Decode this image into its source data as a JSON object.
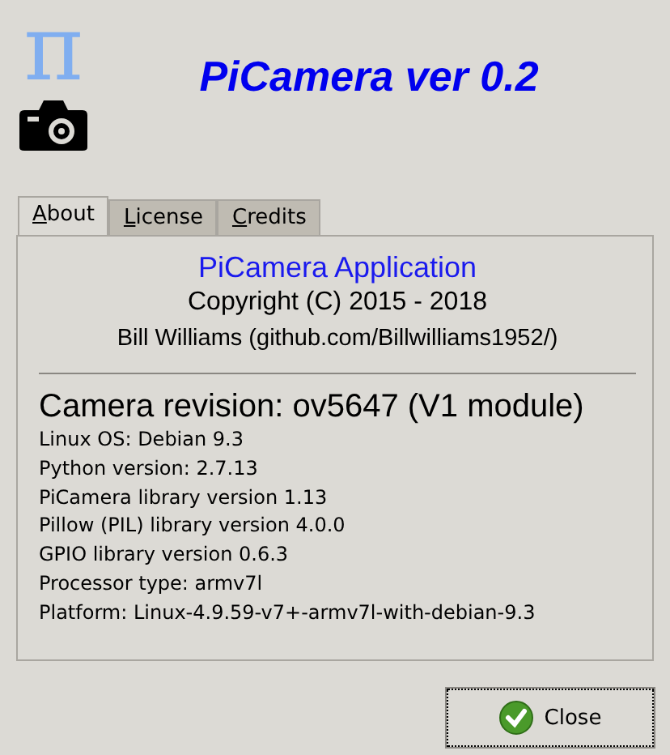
{
  "header": {
    "title": "PiCamera ver 0.2",
    "logo_glyph": "π"
  },
  "tabs": [
    {
      "label": "About",
      "selected": true
    },
    {
      "label": "License",
      "selected": false
    },
    {
      "label": "Credits",
      "selected": false
    }
  ],
  "about": {
    "app_name": "PiCamera Application",
    "copyright": "Copyright (C) 2015 - 2018",
    "author": "Bill Williams (github.com/Billwilliams1952/)",
    "camera_revision": "Camera revision: ov5647 (V1 module)",
    "details": [
      "Linux OS: Debian 9.3",
      "Python version: 2.7.13",
      "PiCamera library version 1.13",
      "Pillow (PIL) library version 4.0.0",
      "GPIO library version 0.6.3",
      "Processor type: armv7l",
      "Platform: Linux-4.9.59-v7+-armv7l-with-debian-9.3"
    ]
  },
  "close_button": "Close"
}
